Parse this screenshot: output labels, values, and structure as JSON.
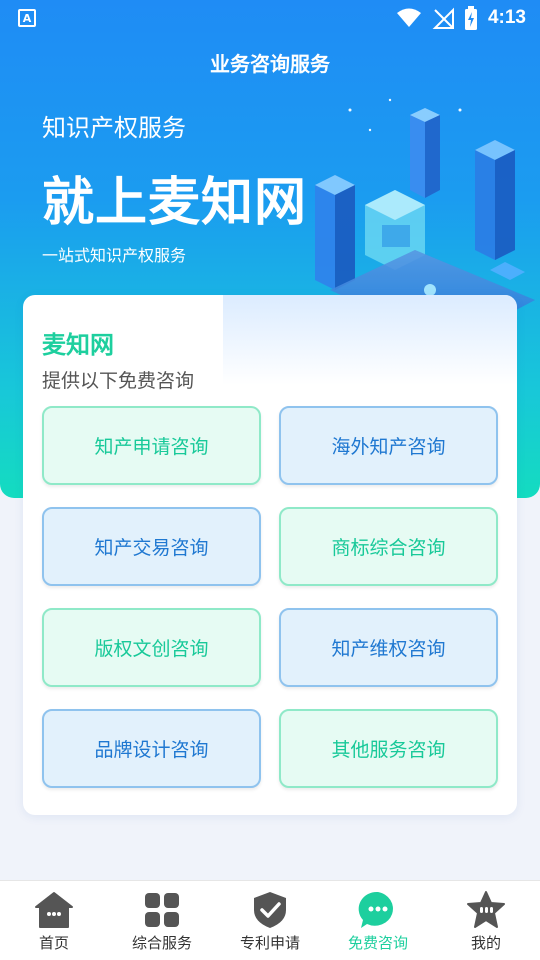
{
  "status_bar": {
    "app_icon_letter": "A",
    "time": "4:13"
  },
  "header": {
    "title": "业务咨询服务"
  },
  "hero": {
    "subtitle": "知识产权服务",
    "headline": "就上麦知网",
    "tagline": "一站式知识产权服务"
  },
  "card": {
    "title": "麦知网",
    "subtitle": "提供以下免费咨询",
    "tiles": [
      {
        "label": "知产申请咨询",
        "style": "green"
      },
      {
        "label": "海外知产咨询",
        "style": "blue"
      },
      {
        "label": "知产交易咨询",
        "style": "blue"
      },
      {
        "label": "商标综合咨询",
        "style": "green"
      },
      {
        "label": "版权文创咨询",
        "style": "green"
      },
      {
        "label": "知产维权咨询",
        "style": "blue"
      },
      {
        "label": "品牌设计咨询",
        "style": "blue"
      },
      {
        "label": "其他服务咨询",
        "style": "green"
      }
    ]
  },
  "tabbar": {
    "active_index": 3,
    "items": [
      {
        "label": "首页",
        "icon": "home-icon"
      },
      {
        "label": "综合服务",
        "icon": "grid-icon"
      },
      {
        "label": "专利申请",
        "icon": "shield-check-icon"
      },
      {
        "label": "免费咨询",
        "icon": "chat-bubble-icon"
      },
      {
        "label": "我的",
        "icon": "star-face-icon"
      }
    ]
  },
  "colors": {
    "accent_green": "#1dcf9e",
    "accent_blue": "#1f78d1",
    "hero_top": "#1f8cf5",
    "hero_bottom": "#14dcc0"
  }
}
